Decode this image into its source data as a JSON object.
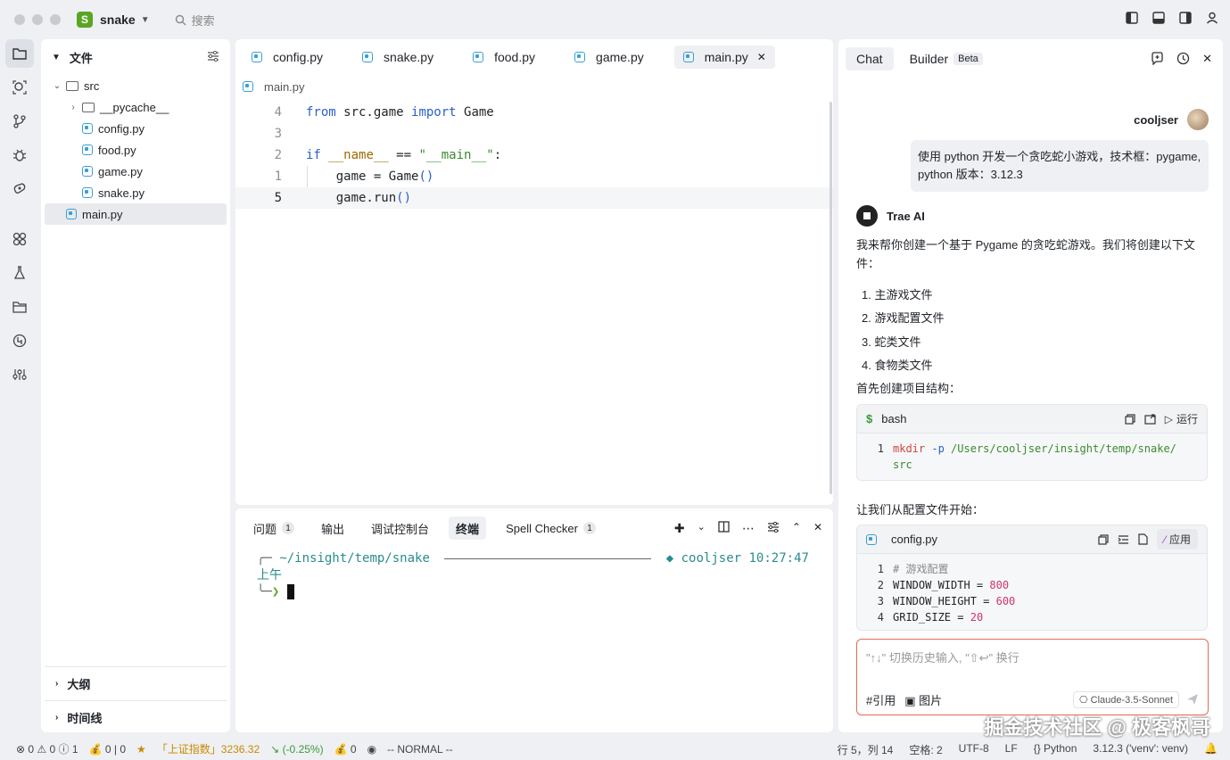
{
  "titlebar": {
    "project_badge": "S",
    "project_name": "snake",
    "search_placeholder": "搜索"
  },
  "explorer": {
    "title": "文件",
    "tree": [
      {
        "label": "src",
        "type": "folder",
        "expanded": true,
        "depth": 0
      },
      {
        "label": "__pycache__",
        "type": "folder",
        "expanded": false,
        "depth": 1
      },
      {
        "label": "config.py",
        "type": "py",
        "depth": 1
      },
      {
        "label": "food.py",
        "type": "py",
        "depth": 1
      },
      {
        "label": "game.py",
        "type": "py",
        "depth": 1
      },
      {
        "label": "snake.py",
        "type": "py",
        "depth": 1
      },
      {
        "label": "main.py",
        "type": "py",
        "depth": 0,
        "selected": true
      }
    ],
    "sections": [
      "大纲",
      "时间线"
    ]
  },
  "editor": {
    "tabs": [
      "config.py",
      "snake.py",
      "food.py",
      "game.py",
      "main.py"
    ],
    "active_tab": "main.py",
    "breadcrumb": "main.py",
    "line_numbers": [
      "4",
      "3",
      "2",
      "1",
      "5"
    ],
    "current_line": "5"
  },
  "panel": {
    "tabs": [
      {
        "label": "问题",
        "badge": "1"
      },
      {
        "label": "输出"
      },
      {
        "label": "调试控制台"
      },
      {
        "label": "终端",
        "active": true
      },
      {
        "label": "Spell Checker",
        "badge": "1"
      }
    ],
    "terminal": {
      "path": "~/insight/temp/snake",
      "user": "cooljser",
      "time": "10:27:47 上午",
      "prompt": "❯"
    }
  },
  "chat": {
    "tabs": [
      "Chat",
      "Builder"
    ],
    "beta_label": "Beta",
    "user_name": "cooljser",
    "user_message": "使用 python 开发一个贪吃蛇小游戏，技术框：pygame, python 版本：3.12.3",
    "ai_name": "Trae AI",
    "ai_intro": "我来帮你创建一个基于 Pygame 的贪吃蛇游戏。我们将创建以下文件：",
    "ai_list": [
      "1. 主游戏文件",
      "2. 游戏配置文件",
      "3. 蛇类文件",
      "4. 食物类文件"
    ],
    "ai_step1": "首先创建项目结构：",
    "bash_block": {
      "lang": "bash",
      "run_label": "运行",
      "line_no": "1",
      "cmd": "mkdir",
      "flag": "-p",
      "path1": "/Users/cooljser/insight/temp/snake/",
      "path2": "src"
    },
    "ai_step2": "让我们从配置文件开始：",
    "config_block": {
      "file": "config.py",
      "apply_label": "应用",
      "lines": [
        {
          "n": "1",
          "text": "# 游戏配置"
        },
        {
          "n": "2",
          "name": "WINDOW_WIDTH",
          "value": "800"
        },
        {
          "n": "3",
          "name": "WINDOW_HEIGHT",
          "value": "600"
        },
        {
          "n": "4",
          "name": "GRID_SIZE",
          "value": "20"
        }
      ]
    },
    "input_placeholder": "\"↑↓\" 切换历史输入, \"⇧↩\" 换行",
    "ref_label": "#引用",
    "image_label": "图片",
    "model": "Claude-3.5-Sonnet"
  },
  "status": {
    "errors": "0",
    "warnings": "0",
    "infos": "1",
    "money": "0 | 0",
    "index_name": "「上证指数」3236.32",
    "index_change": "(-0.25%)",
    "money2": "0",
    "mode": "-- NORMAL --",
    "position": "行 5，列 14",
    "spaces": "空格: 2",
    "encoding": "UTF-8",
    "eol": "LF",
    "lang": "Python",
    "interpreter": "3.12.3 ('venv': venv)"
  },
  "watermark": "掘金技术社区 @ 极客枫哥",
  "colors": {
    "accent_green": "#5aa623",
    "python_blue": "#3b9fd6",
    "input_border": "#e06b55"
  }
}
